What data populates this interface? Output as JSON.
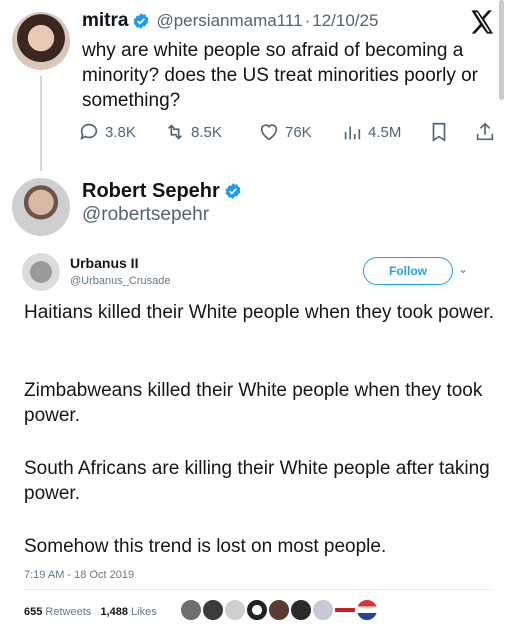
{
  "tweet": {
    "author_name": "mitra",
    "handle": "@persianmama111",
    "separator": "·",
    "date": "12/10/25",
    "text": "why are white people so afraid of becoming a minority? does the US treat minorities poorly or something?",
    "replies": "3.8K",
    "reposts": "8.5K",
    "likes": "76K",
    "views": "4.5M"
  },
  "reply": {
    "author_name": "Robert Sepehr",
    "handle": "@robertsepehr"
  },
  "embedded": {
    "author_name": "Urbanus II",
    "handle": "@Urbanus_Crusade",
    "follow_label": "Follow",
    "chevron": "⌄",
    "paragraphs": [
      "Haitians killed their White people when they took power.",
      "Zimbabweans killed their White people when they took power.",
      "South Africans are killing their White people after taking power.",
      "Somehow this trend is lost on most people."
    ],
    "timestamp": "7:19 AM - 18 Oct 2019",
    "retweets_count": "655",
    "retweets_label": "Retweets",
    "likes_count": "1,488",
    "likes_label": "Likes"
  },
  "colors": {
    "verified": "#1d9bf0",
    "secondary_text": "#536471",
    "follow_blue": "#1da1f2"
  }
}
